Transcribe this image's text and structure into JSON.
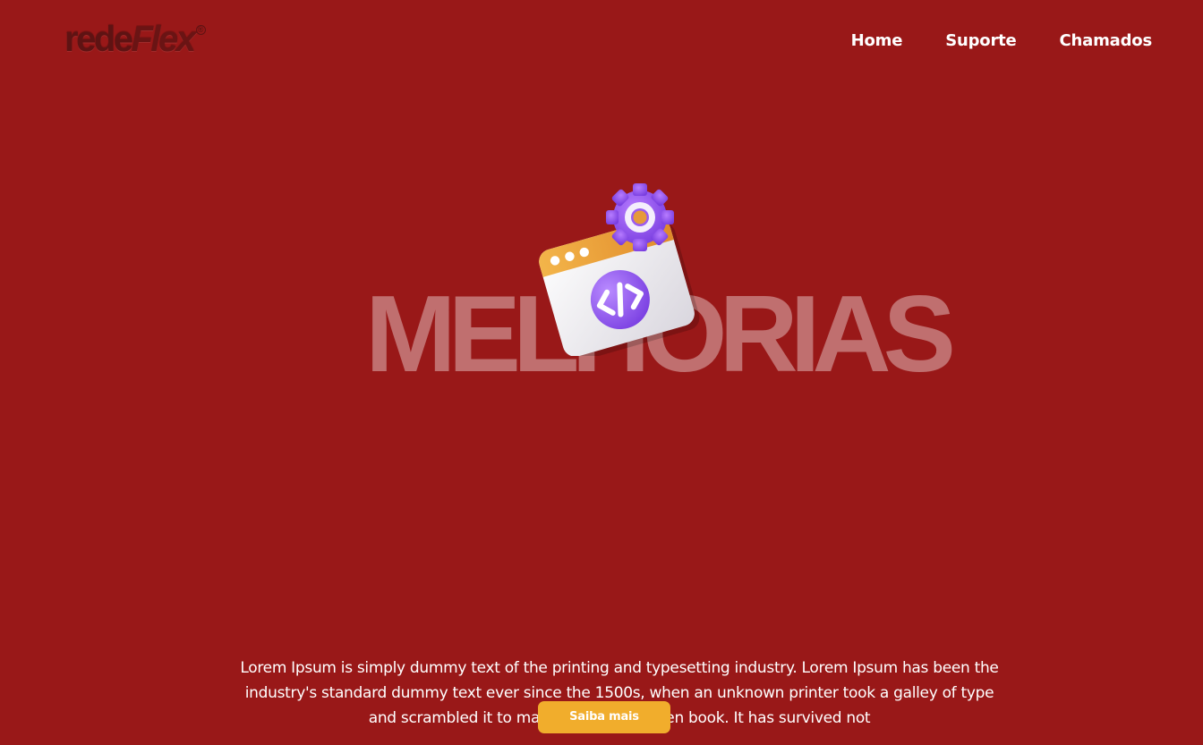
{
  "header": {
    "logo": {
      "text_main": "rede",
      "text_accent": "Flex",
      "registered_mark": "®"
    },
    "nav": [
      {
        "label": "Home"
      },
      {
        "label": "Suporte"
      },
      {
        "label": "Chamados"
      }
    ]
  },
  "hero": {
    "title": "MELHORIAS",
    "illustration_icon": "code-window-gear-icon",
    "description": "Lorem Ipsum is simply dummy text of the printing and typesetting industry. Lorem Ipsum has been the industry's standard dummy text ever since the 1500s, when an unknown printer took a galley of type and scrambled it to make a type specimen book. It has survived not",
    "cta_label": "Saiba mais"
  },
  "colors": {
    "background": "#991818",
    "cta": "#f1ad2c",
    "title_overlay": "rgba(255,255,255,0.38)",
    "text": "#ffffff",
    "illustration_gear": "#9b5cf0",
    "illustration_bar": "#f0a23a"
  }
}
